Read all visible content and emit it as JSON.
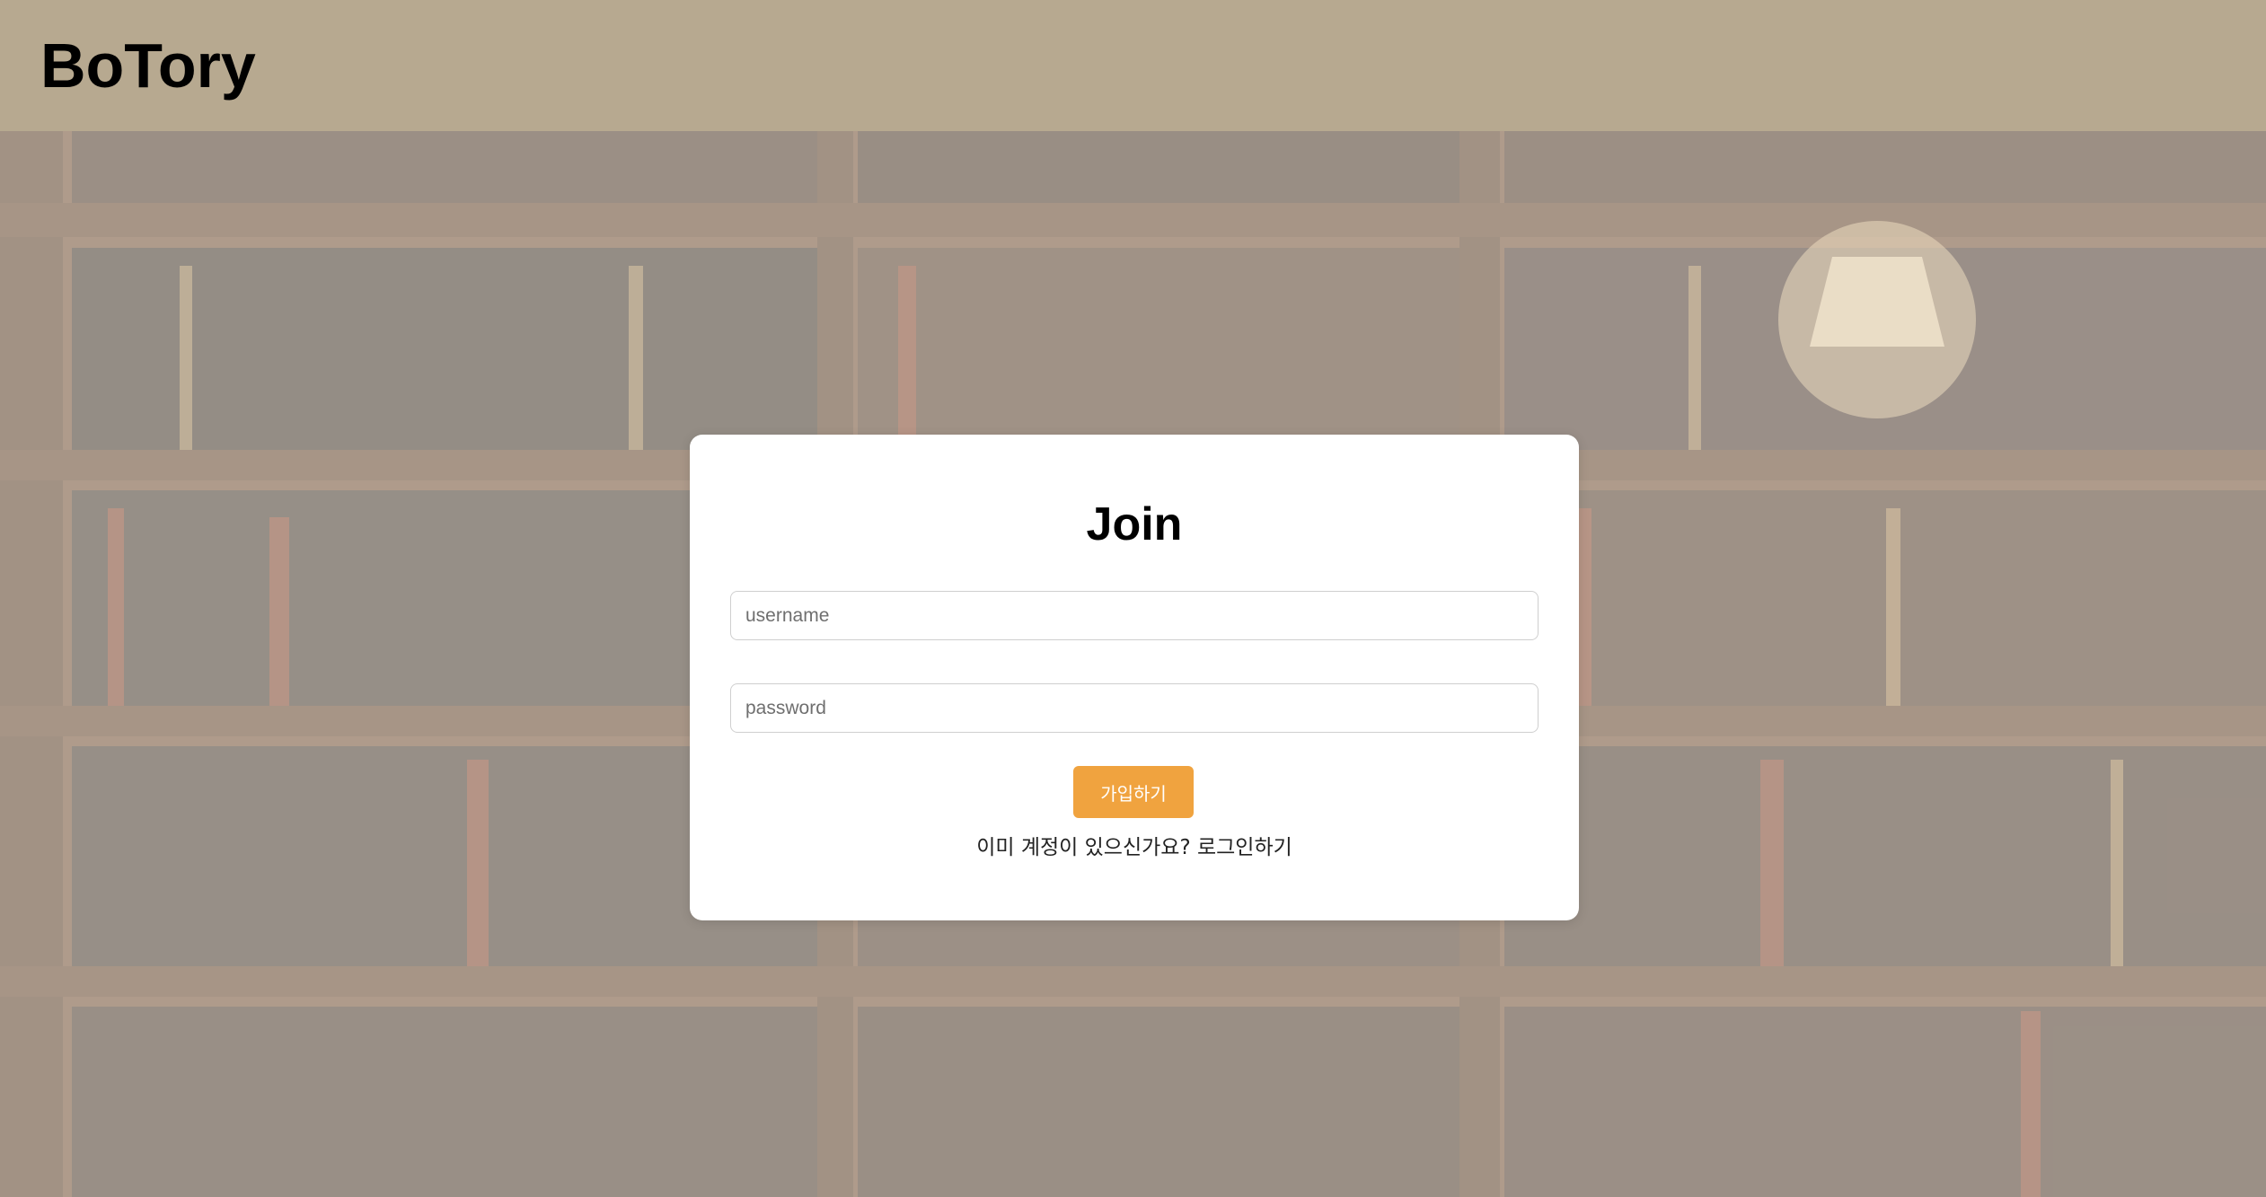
{
  "header": {
    "brand": "BoTory"
  },
  "join_form": {
    "title": "Join",
    "username_placeholder": "username",
    "password_placeholder": "password",
    "submit_label": "가입하기",
    "existing_account_text": "이미 계정이 있으신가요?",
    "login_link": "로그인하기"
  },
  "colors": {
    "header_bg": "#b7a990",
    "submit_bg": "#f0a33f",
    "card_bg": "#ffffff"
  }
}
